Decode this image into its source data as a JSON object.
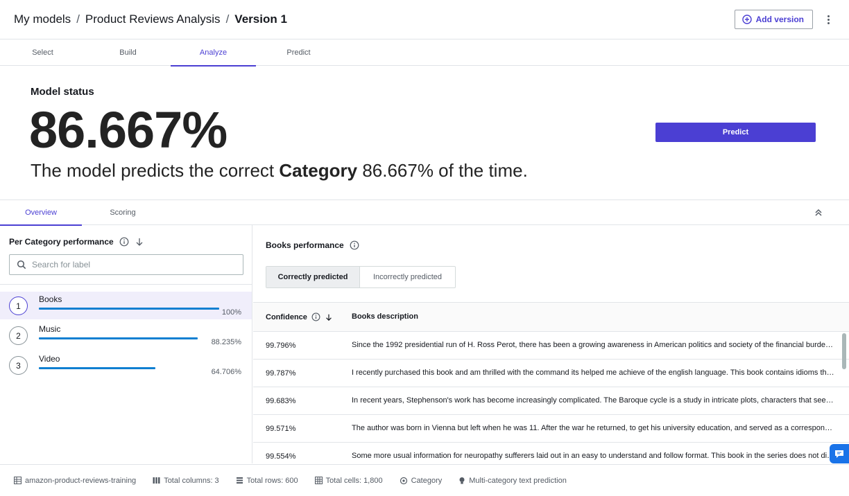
{
  "breadcrumb": {
    "root": "My models",
    "project": "Product Reviews Analysis",
    "current": "Version 1",
    "separator": "/"
  },
  "header": {
    "add_version_label": "Add version"
  },
  "tabs": [
    {
      "label": "Select"
    },
    {
      "label": "Build"
    },
    {
      "label": "Analyze",
      "active": true
    },
    {
      "label": "Predict"
    }
  ],
  "status": {
    "title": "Model status",
    "accuracy": "86.667%",
    "sentence_pre": "The model predicts the correct ",
    "sentence_target": "Category",
    "sentence_post": " 86.667% of the time.",
    "predict_label": "Predict"
  },
  "subtabs": [
    {
      "label": "Overview",
      "active": true
    },
    {
      "label": "Scoring"
    }
  ],
  "left_panel": {
    "title": "Per Category performance",
    "search_placeholder": "Search for label",
    "categories": [
      {
        "rank": "1",
        "name": "Books",
        "percent": "100%",
        "value": 1.0,
        "selected": true
      },
      {
        "rank": "2",
        "name": "Music",
        "percent": "88.235%",
        "value": 0.88235
      },
      {
        "rank": "3",
        "name": "Video",
        "percent": "64.706%",
        "value": 0.64706
      }
    ]
  },
  "right_panel": {
    "title": "Books performance",
    "segments": {
      "correct": "Correctly predicted",
      "incorrect": "Incorrectly predicted"
    },
    "table": {
      "col_confidence": "Confidence",
      "col_description": "Books description",
      "rows": [
        {
          "confidence": "99.796%",
          "description": "Since the 1992 presidential run of H. Ross Perot, there has been a growing awareness in American politics and society of the financial burden of the national debt."
        },
        {
          "confidence": "99.787%",
          "description": "I recently purchased this book and am thrilled with the command its helped me achieve of the english language. This book contains idioms that are used every day."
        },
        {
          "confidence": "99.683%",
          "description": "In recent years, Stephenson's work has become increasingly complicated. The Baroque cycle is a study in intricate plots, characters that seem to come and go."
        },
        {
          "confidence": "99.571%",
          "description": "The author was born in Vienna but left when he was 11. After the war he returned, to get his university education, and served as a correspondent abroad."
        },
        {
          "confidence": "99.554%",
          "description": "Some more usual information for neuropathy sufferers laid out in an easy to understand and follow format. This book in the series does not disappoint."
        }
      ]
    }
  },
  "footer": {
    "dataset": "amazon-product-reviews-training",
    "columns": "Total columns: 3",
    "rows": "Total rows: 600",
    "cells": "Total cells: 1,800",
    "target": "Category",
    "model_type": "Multi-category text prediction"
  },
  "colors": {
    "accent": "#4b3fd3",
    "bar": "#0f7fd1",
    "selected_row": "#f0eefb"
  }
}
